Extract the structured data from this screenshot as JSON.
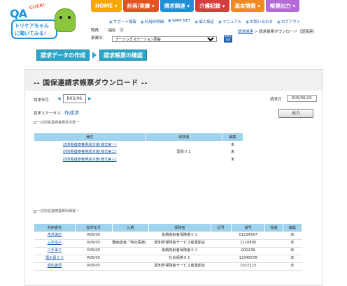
{
  "header": {
    "logo": {
      "qa": "QA",
      "click": "CLICK!",
      "line1": "トリケアちゃん",
      "line2": "に聞いてみる！"
    },
    "nav": [
      {
        "label": "HOME ▾",
        "color": "#f5a800"
      },
      {
        "label": "計画/実績 ▾",
        "color": "#e2531f"
      },
      {
        "label": "請求関連 ▾",
        "color": "#1f8fd6"
      },
      {
        "label": "介護記録 ▾",
        "color": "#d63e3e"
      },
      {
        "label": "基本情報 ▾",
        "color": "#f08a24"
      },
      {
        "label": "帳票出力 ▾",
        "color": "#b26bd6"
      }
    ],
    "sublinks": [
      "サポート情報",
      "利用料明細",
      "WAM NET",
      "個人設定",
      "マニュアル",
      "お問い合わせ",
      "ログアウト"
    ],
    "staff_label": "職員：",
    "staff_name": "福祉　次",
    "office_label": "事業所：",
    "office_value": "ナーシングステーション岡谷",
    "change_btn": "事業所変更",
    "breadcrumb_link": "請求関連",
    "breadcrumb_sep": ">",
    "breadcrumb_current": "請求帳票ダウンロード（国保連）"
  },
  "steps": [
    "請求データの作成",
    "請求帳票の確認"
  ],
  "panel": {
    "title": "-- 国保連請求帳票ダウンロード --",
    "ym_label": "請求年月",
    "ym_prev": "◀",
    "ym_value": "R05/06",
    "ym_next": "▶",
    "request_date_label": "請求日",
    "request_date": "R05/06/29",
    "status_label": "請求ステータス：",
    "status_value": "作成済",
    "output_button": "出力",
    "caption1": "一訪問看護療養費請求書一",
    "caption2": "一訪問看護療養費明細書一"
  },
  "table1": {
    "headers": [
      "様式",
      "保険者",
      "編集"
    ],
    "rows": [
      {
        "form": "訪問看護療養費請求書(様式第一)",
        "insurer": "",
        "edit": "未"
      },
      {
        "form": "訪問看護療養費請求書(様式第二)",
        "insurer": "国保０１",
        "edit": "未"
      },
      {
        "form": "訪問看護療養費請求書(様式第三)",
        "insurer": "",
        "edit": "未"
      }
    ]
  },
  "table2": {
    "headers": [
      "利用者名",
      "提供年月",
      "公費",
      "保険者",
      "記号",
      "番号",
      "枝番",
      "編集"
    ],
    "rows": [
      {
        "name": "荒井満志",
        "ym": "R05/05",
        "pub": "",
        "insurer": "後期高齢者保険者０１",
        "mark": "",
        "num": "01234567",
        "branch": "",
        "edit": "未"
      },
      {
        "name": "三手窪子",
        "ym": "R05/05",
        "pub": "難病患者「特定医療」",
        "insurer": "愛知県保険者サービス産業組合",
        "mark": "",
        "num": "1210890",
        "branch": "",
        "edit": "未"
      },
      {
        "name": "三手事子",
        "ym": "R05/05",
        "pub": "",
        "insurer": "後期高齢者保険者０１",
        "mark": "",
        "num": "000238",
        "branch": "",
        "edit": "未"
      },
      {
        "name": "振示裏３つ",
        "ym": "R05/05",
        "pub": "",
        "insurer": "社会保険０１",
        "mark": "",
        "num": "12345678",
        "branch": "",
        "edit": "未"
      },
      {
        "name": "昭和謙佰",
        "ym": "R05/05",
        "pub": "",
        "insurer": "愛知県保険者サービス産業組合",
        "mark": "",
        "num": "1027223",
        "branch": "",
        "edit": "未"
      }
    ]
  }
}
